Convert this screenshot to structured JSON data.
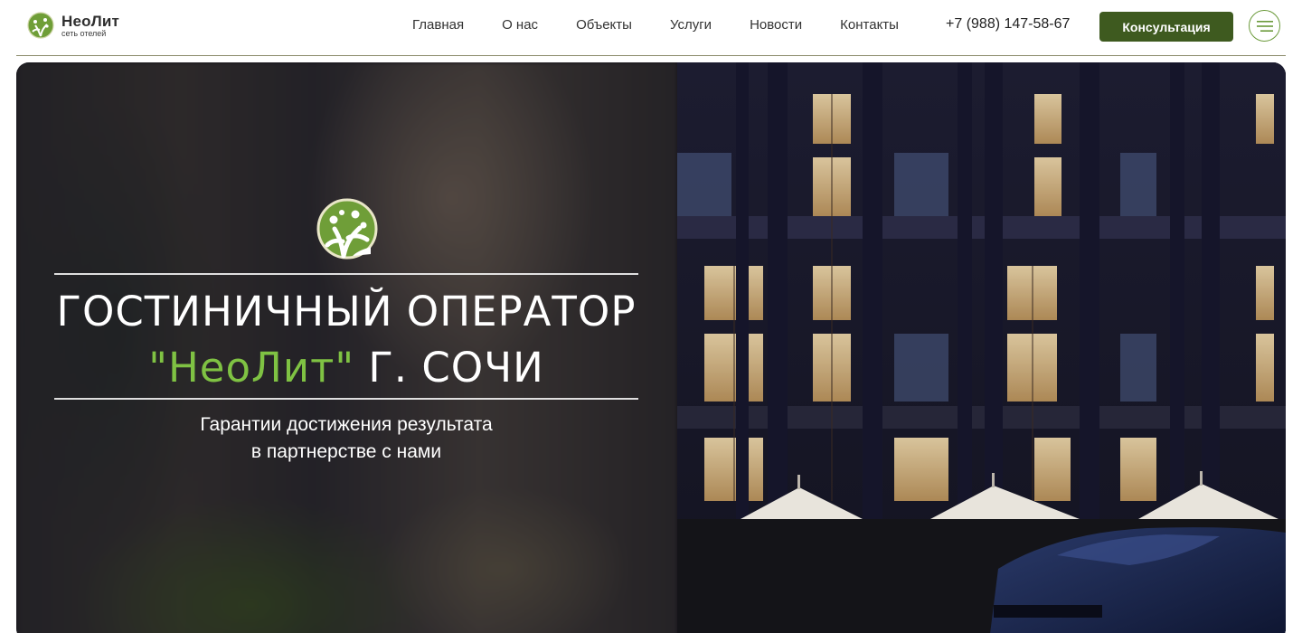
{
  "header": {
    "logo": {
      "name": "НеоЛит",
      "subtitle": "сеть отелей"
    },
    "nav": [
      {
        "label": "Главная"
      },
      {
        "label": "О нас"
      },
      {
        "label": "Объекты"
      },
      {
        "label": "Услуги"
      },
      {
        "label": "Новости"
      },
      {
        "label": "Контакты"
      }
    ],
    "phone": "+7 (988) 147-58-67",
    "cta_label": "Консультация",
    "menu_icon": "hamburger-menu-icon"
  },
  "hero": {
    "title_line1": "ГОСТИНИЧНЫЙ ОПЕРАТОР",
    "title_brand": "\"НеоЛит\"",
    "title_line2_rest": " Г. СОЧИ",
    "subtitle_line1": "Гарантии достижения результата",
    "subtitle_line2": "в партнерстве с нами",
    "emblem_icon": "tree-logo-icon"
  },
  "colors": {
    "brand_green": "#3e5a1f",
    "accent_green": "#7fc243",
    "menu_ring": "#6b9a3a"
  }
}
